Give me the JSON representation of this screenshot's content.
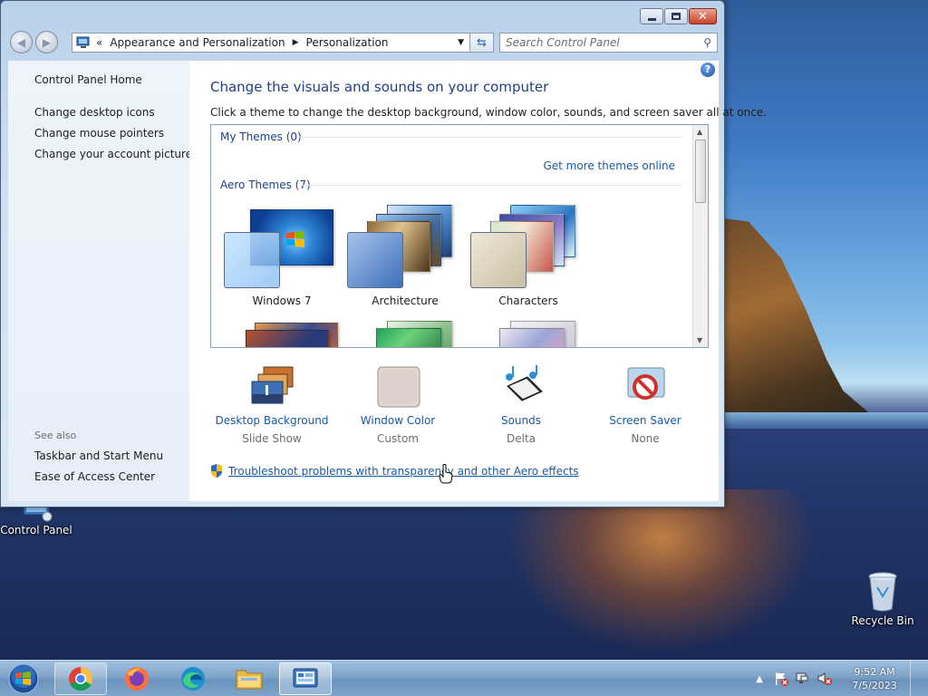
{
  "window": {
    "address": {
      "overflow": "«",
      "crumb1": "Appearance and Personalization",
      "crumb2": "Personalization"
    },
    "search_placeholder": "Search Control Panel",
    "caption": {
      "minimize": "",
      "maximize": "",
      "close": "✕"
    }
  },
  "left_pane": {
    "home": "Control Panel Home",
    "links": [
      "Change desktop icons",
      "Change mouse pointers",
      "Change your account picture"
    ],
    "see_also_label": "See also",
    "see_also": [
      "Taskbar and Start Menu",
      "Ease of Access Center"
    ]
  },
  "main": {
    "heading": "Change the visuals and sounds on your computer",
    "subtitle": "Click a theme to change the desktop background, window color, sounds, and screen saver all at once.",
    "my_themes": "My Themes (0)",
    "get_more": "Get more themes online",
    "aero_themes": "Aero Themes (7)",
    "themes": [
      "Windows 7",
      "Architecture",
      "Characters"
    ],
    "tiles": [
      {
        "title": "Desktop Background",
        "sub": "Slide Show",
        "icon": "desktop-background-icon"
      },
      {
        "title": "Window Color",
        "sub": "Custom",
        "icon": "window-color-icon"
      },
      {
        "title": "Sounds",
        "sub": "Delta",
        "icon": "sounds-icon"
      },
      {
        "title": "Screen Saver",
        "sub": "None",
        "icon": "screen-saver-icon"
      }
    ],
    "troubleshoot": "Troubleshoot problems with transparency and other Aero effects"
  },
  "desktop": {
    "control_panel": "Control Panel",
    "recycle_bin": "Recycle Bin"
  },
  "taskbar": {
    "apps": [
      "chrome",
      "firefox",
      "edge",
      "file-explorer",
      "control-panel"
    ],
    "time": "9:52 AM",
    "date": "7/5/2023"
  },
  "colors": {
    "link": "#1559a8",
    "heading": "#1e3f8a",
    "taskbar": "#7fa4c8"
  }
}
